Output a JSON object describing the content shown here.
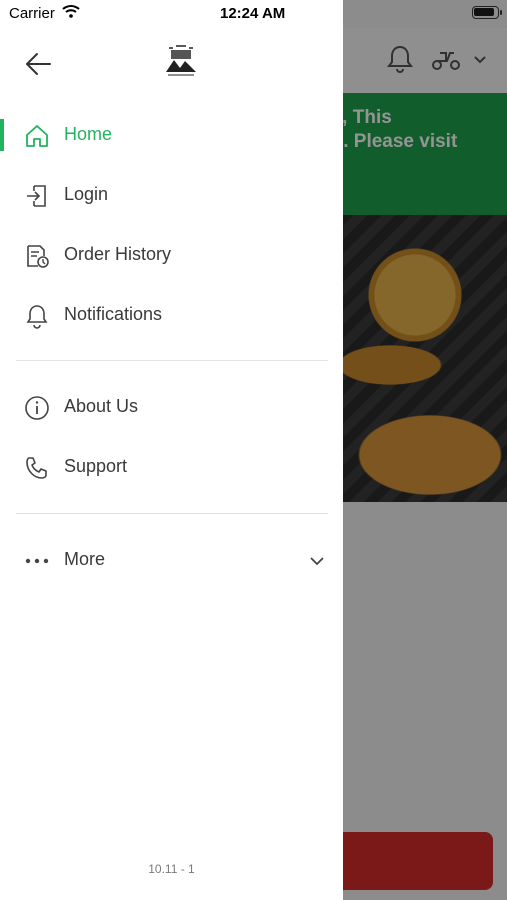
{
  "status_bar": {
    "carrier": "Carrier",
    "time": "12:24 AM",
    "battery_level": 0.9
  },
  "background": {
    "banner_text": "ed, This\non. Please visit\ny",
    "accent_color": "#1ea14a",
    "button_color": "#d42b2b"
  },
  "drawer": {
    "back_icon": "arrow-left-icon",
    "logo_icon": "restaurant-logo",
    "menu": [
      {
        "label": "Home",
        "icon": "home-icon",
        "active": true
      },
      {
        "label": "Login",
        "icon": "login-icon",
        "active": false
      },
      {
        "label": "Order History",
        "icon": "order-history-icon",
        "active": false
      },
      {
        "label": "Notifications",
        "icon": "bell-icon",
        "active": false
      }
    ],
    "secondary_menu": [
      {
        "label": "About Us",
        "icon": "info-icon"
      },
      {
        "label": "Support",
        "icon": "phone-icon"
      }
    ],
    "more": {
      "label": "More",
      "icon": "more-dots-icon",
      "expand_icon": "chevron-down-icon"
    },
    "version": "10.11 - 1",
    "active_color": "#22b35e"
  }
}
